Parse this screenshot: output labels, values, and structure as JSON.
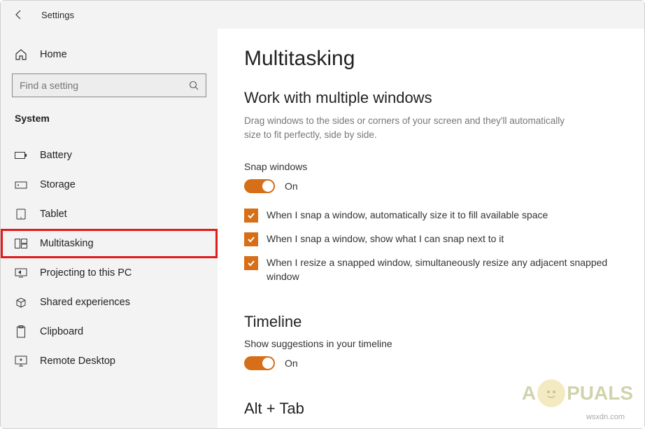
{
  "window": {
    "title": "Settings"
  },
  "sidebar": {
    "home_label": "Home",
    "search_placeholder": "Find a setting",
    "section_header": "System",
    "items": [
      {
        "label": "Battery"
      },
      {
        "label": "Storage"
      },
      {
        "label": "Tablet"
      },
      {
        "label": "Multitasking"
      },
      {
        "label": "Projecting to this PC"
      },
      {
        "label": "Shared experiences"
      },
      {
        "label": "Clipboard"
      },
      {
        "label": "Remote Desktop"
      }
    ]
  },
  "page": {
    "title": "Multitasking",
    "sections": {
      "snap": {
        "title": "Work with multiple windows",
        "description": "Drag windows to the sides or corners of your screen and they'll automatically size to fit perfectly, side by side.",
        "toggle_label": "Snap windows",
        "toggle_state": "On",
        "checks": [
          "When I snap a window, automatically size it to fill available space",
          "When I snap a window, show what I can snap next to it",
          "When I resize a snapped window, simultaneously resize any adjacent snapped window"
        ]
      },
      "timeline": {
        "title": "Timeline",
        "toggle_label": "Show suggestions in your timeline",
        "toggle_state": "On"
      },
      "alttab": {
        "title": "Alt + Tab"
      }
    }
  },
  "watermark": {
    "prefix": "A",
    "suffix": "PUALS",
    "attrib": "wsxdn.com"
  },
  "colors": {
    "accent": "#d66f17",
    "highlight": "#e11a1a"
  }
}
